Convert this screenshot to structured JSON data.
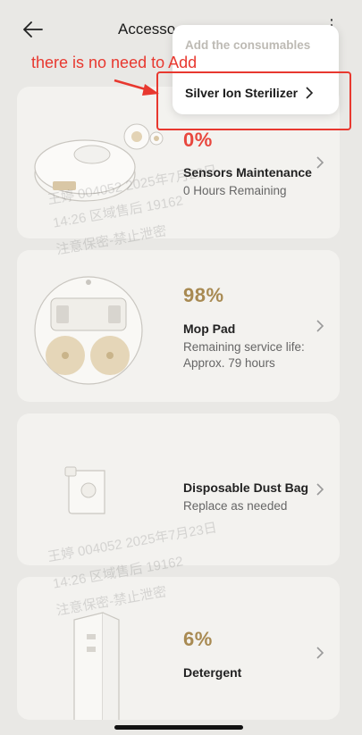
{
  "header": {
    "title": "Accesso",
    "more_label": "⋮"
  },
  "popup": {
    "heading": "Add the consumables",
    "item_label": "Silver Ion Sterilizer"
  },
  "annotation": {
    "text": "there is no need to Add",
    "color": "#e8382f"
  },
  "accessories": [
    {
      "percent": "0%",
      "percent_color": "#e8473e",
      "name": "Sensors Maintenance",
      "status": "0 Hours Remaining"
    },
    {
      "percent": "98%",
      "percent_color": "#a88a52",
      "name": "Mop Pad",
      "status": "Remaining service life: Approx. 79 hours"
    },
    {
      "percent": "",
      "percent_color": "#a88a52",
      "name": "Disposable Dust Bag",
      "status": "Replace as needed"
    },
    {
      "percent": "6%",
      "percent_color": "#a88a52",
      "name": "Detergent",
      "status": ""
    }
  ],
  "watermark": {
    "line1": "王婷 004052 2025年7月23日",
    "line2": "14:26 区域售后 19162",
    "line3": "注意保密-禁止泄密"
  }
}
